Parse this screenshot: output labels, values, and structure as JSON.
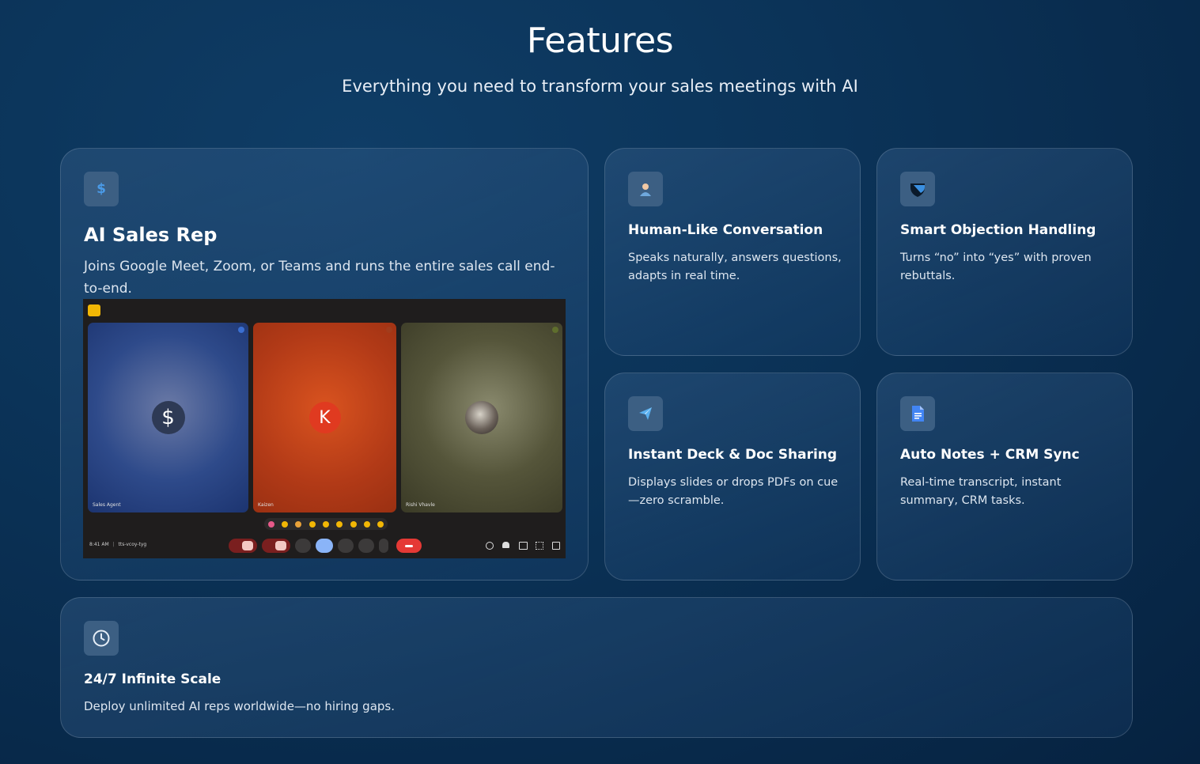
{
  "header": {
    "title": "Features",
    "subtitle": "Everything you need to transform your sales meetings with AI"
  },
  "cards": {
    "sales_rep": {
      "icon": "dollar-icon",
      "title": "AI Sales Rep",
      "desc": "Joins Google Meet, Zoom, or Teams and runs the entire sales call end-to-end."
    },
    "human": {
      "icon": "person-icon",
      "title": "Human-Like Conversation",
      "desc": "Speaks naturally, answers questions, adapts in real time."
    },
    "objection": {
      "icon": "shield-icon",
      "title": "Smart Objection Handling",
      "desc": "Turns “no” into “yes” with proven rebuttals."
    },
    "deck": {
      "icon": "paper-plane-icon",
      "title": "Instant Deck & Doc Sharing",
      "desc": "Displays slides or drops PDFs on cue—zero scramble."
    },
    "notes": {
      "icon": "document-icon",
      "title": "Auto Notes + CRM Sync",
      "desc": "Real-time transcript, instant summary, CRM tasks."
    },
    "scale": {
      "icon": "clock-icon",
      "title": "24/7 Infinite Scale",
      "desc": "Deploy unlimited AI reps worldwide—no hiring gaps."
    }
  },
  "meeting": {
    "tiles": [
      {
        "name": "Sales Agent",
        "avatar": "$"
      },
      {
        "name": "Kaizen",
        "avatar": "K"
      },
      {
        "name": "Rishi Vhavle",
        "avatar": ""
      }
    ],
    "time": "8:41 AM",
    "code": "tts-vcoy-tyg"
  },
  "colors": {
    "accent_blue": "#4a9be8",
    "end_call_red": "#e53935",
    "tile_blue": "#2b4a8a",
    "tile_orange": "#c2401b",
    "tile_olive": "#4a4a2f"
  }
}
